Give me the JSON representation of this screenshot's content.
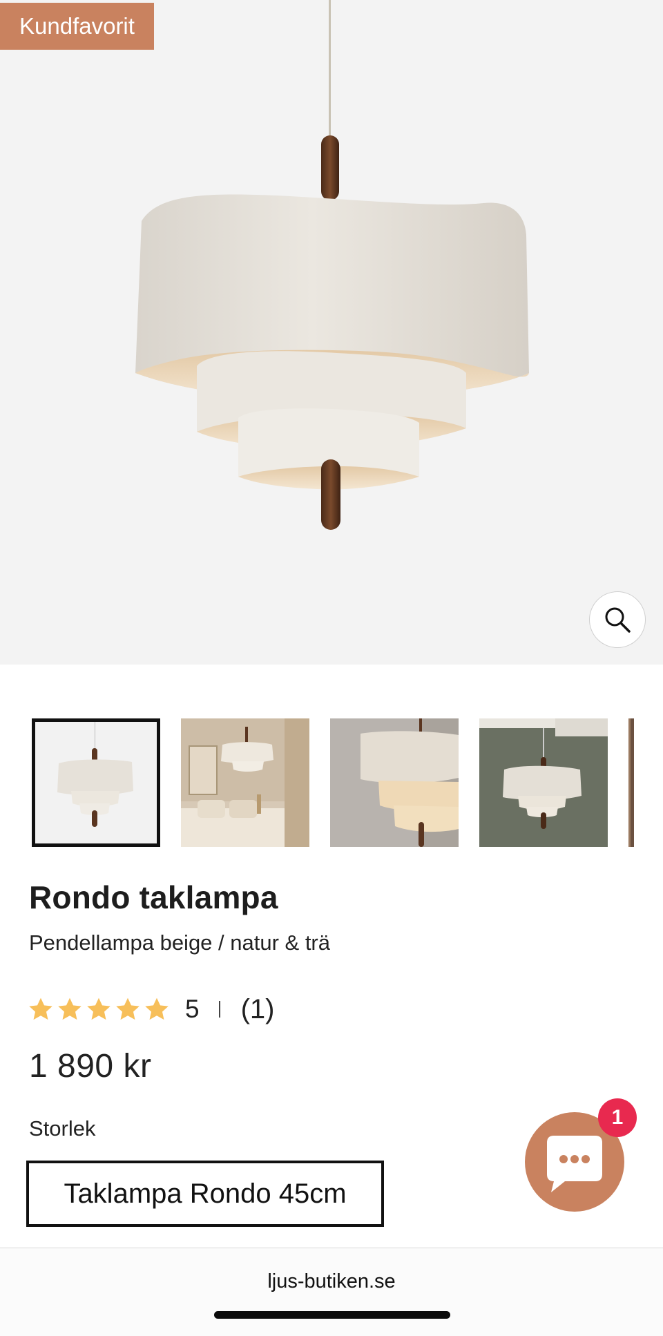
{
  "badge": {
    "label": "Kundfavorit"
  },
  "product": {
    "title": "Rondo taklampa",
    "subtitle": "Pendellampa beige / natur & trä",
    "rating": {
      "value": "5",
      "count": "(1)",
      "stars": 5
    },
    "price": "1 890 kr"
  },
  "options": {
    "size_label": "Storlek",
    "size_selected": "Taklampa Rondo 45cm"
  },
  "chat": {
    "unread": "1"
  },
  "browser": {
    "url": "ljus-butiken.se"
  },
  "colors": {
    "badge": "#c9825f",
    "chat": "#c9825f",
    "chat_badge": "#e8294f",
    "star": "#f7bf5a"
  }
}
